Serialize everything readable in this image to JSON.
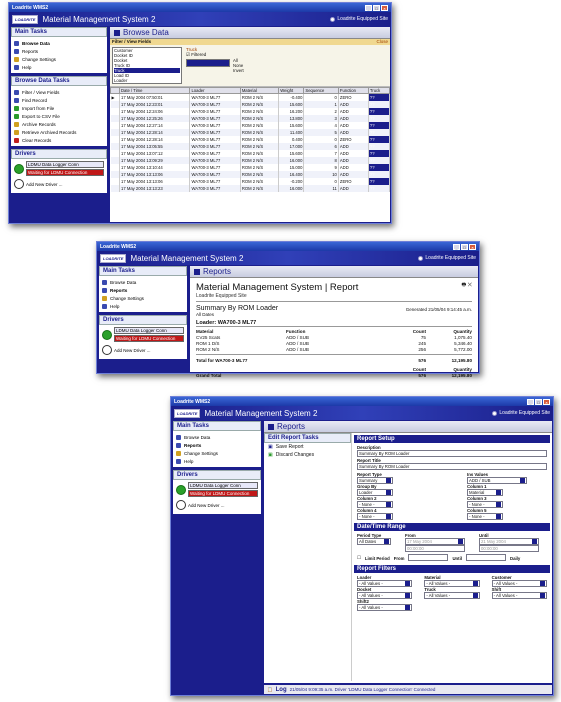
{
  "app": {
    "window_title": "Loadrite WMS2",
    "app_title": "Material Management System 2",
    "logo": "LOADRITE",
    "site": "Loadrite Equipped Site"
  },
  "sidebar": {
    "main_tasks_header": "Main Tasks",
    "main_tasks": [
      "Browse Data",
      "Reports",
      "Change Settings",
      "Help"
    ],
    "browse_tasks_header": "Browse Data Tasks",
    "browse_tasks": [
      "Filter / View Fields",
      "Find Record",
      "Import from File",
      "Export to CSV File",
      "Archive Records",
      "Retrieve Archived Records",
      "Clear Records"
    ],
    "drivers_header": "Drivers",
    "driver_name": "LDMU Data Logger Conn",
    "driver_status": "Waiting for LDMU Connection",
    "add_driver": "Add New Driver ..."
  },
  "browse": {
    "title": "Browse Data",
    "filter_header": "Filter / View Fields",
    "close": "Close",
    "fields": [
      "Customer",
      "Docket ID",
      "Docket",
      "Truck ID",
      "Truck",
      "Load ID",
      "Loader"
    ],
    "selected_field": "Truck",
    "filtered_label": "Filtered",
    "truck_label": "Truck",
    "opts": [
      "All",
      "None",
      "Invert"
    ],
    "columns": [
      "Date / Time",
      "Loader",
      "Material",
      "Weight",
      "Sequence",
      "Function",
      "Truck"
    ],
    "rows": [
      [
        "17 May 2004 07:50:01",
        "WA700-3 ML77",
        "ROM 2 N/S",
        "-0.400",
        "0",
        "ZERO",
        "??"
      ],
      [
        "17 May 2004 12:23:01",
        "WA700-3 ML77",
        "ROM 2 N/S",
        "15.600",
        "1",
        "ADD",
        "??"
      ],
      [
        "17 May 2004 12:24:06",
        "WA700-3 ML77",
        "ROM 2 N/S",
        "16.200",
        "2",
        "ADD",
        "??"
      ],
      [
        "17 May 2004 12:25:26",
        "WA700-3 ML77",
        "ROM 2 N/S",
        "13.800",
        "3",
        "ADD",
        "??"
      ],
      [
        "17 May 2004 12:27:14",
        "WA700-3 ML77",
        "ROM 2 N/S",
        "15.600",
        "4",
        "ADD",
        "??"
      ],
      [
        "17 May 2004 12:28:14",
        "WA700-3 ML77",
        "ROM 2 N/S",
        "11.400",
        "5",
        "ADD",
        "??"
      ],
      [
        "17 May 2004 12:28:14",
        "WA700-3 ML77",
        "ROM 2 N/S",
        "0.400",
        "0",
        "ZERO",
        "??"
      ],
      [
        "17 May 2004 13:05:55",
        "WA700-3 ML77",
        "ROM 2 N/S",
        "17.000",
        "6",
        "ADD",
        "??"
      ],
      [
        "17 May 2004 13:07:12",
        "WA700-3 ML77",
        "ROM 2 N/S",
        "15.600",
        "7",
        "ADD",
        "??"
      ],
      [
        "17 May 2004 13:09:29",
        "WA700-3 ML77",
        "ROM 2 N/S",
        "16.000",
        "8",
        "ADD",
        "??"
      ],
      [
        "17 May 2004 13:10:44",
        "WA700-3 ML77",
        "ROM 2 N/S",
        "15.000",
        "9",
        "ADD",
        "??"
      ],
      [
        "17 May 2004 13:13:06",
        "WA700-3 ML77",
        "ROM 2 N/S",
        "16.400",
        "10",
        "ADD",
        "??"
      ],
      [
        "17 May 2004 13:13:06",
        "WA700-3 ML77",
        "ROM 2 N/S",
        "-0.200",
        "0",
        "ZERO",
        "??"
      ],
      [
        "17 May 2004 13:13:23",
        "WA700-3 ML77",
        "ROM 2 N/S",
        "16.000",
        "11",
        "ADD",
        "??"
      ]
    ]
  },
  "report": {
    "title": "Reports",
    "heading": "Material Management System | Report",
    "site": "Loadrite Equipped Site",
    "name": "Summary By ROM Loader",
    "scope": "All Dates",
    "generated": "Generated 21/05/04 9:14:45 a.m.",
    "loader_heading": "Loader: WA700-3 ML77",
    "col_material": "Material",
    "col_function": "Function",
    "col_count": "Count",
    "col_quantity": "Quantity",
    "items": [
      [
        "CV25 Scats",
        "ADD / SUB",
        "75",
        "1,075.40"
      ],
      [
        "ROM 1 D/S",
        "ADD / SUB",
        "245",
        "5,346.40"
      ],
      [
        "ROM 2 N/S",
        "ADD / SUB",
        "256",
        "5,772.00"
      ]
    ],
    "total_label": "Total for WA700-3 ML77",
    "total_count": "576",
    "total_qty": "12,195.80",
    "grand_label": "Grand Total",
    "grand_count": "576",
    "grand_qty": "12,195.80"
  },
  "edit": {
    "title": "Reports",
    "tasks_header": "Edit Report Tasks",
    "save": "Save Report",
    "discard": "Discard Changes",
    "setup_header": "Report Setup",
    "description_label": "Description",
    "description_value": "Summary By ROM Loader",
    "rtitle_label": "Report Title",
    "rtitle_value": "Summary By ROM Loader",
    "type_label": "Report Type",
    "type_value": "Summary",
    "ins_label": "Ins Values",
    "ins_value": "ADD / SUB",
    "groupby_label": "Group By",
    "groupby_value": "Loader",
    "col1_label": "Column 1",
    "col1_value": "Material",
    "col2_label": "Column 2",
    "col2_value": "- None -",
    "col3_label": "Column 3",
    "col3_value": "- None -",
    "col4_label": "Column 4",
    "col4_value": "- None -",
    "col5_label": "Column 5",
    "col5_value": "- None -",
    "date_header": "Date/Time Range",
    "period_label": "Period Type",
    "period_value": "All Dates",
    "from_label": "From",
    "from_date": "17 May 2004",
    "from_time": "00:00:00",
    "until_label": "Until",
    "until_date": "21 May 2004",
    "until_time": "00:00:00",
    "limit_label": "Limit Period",
    "limit_from": "From",
    "limit_until": "Until",
    "limit_daily": "Daily",
    "filters_header": "Report Filters",
    "filters": [
      [
        "Loader",
        "- All Values -"
      ],
      [
        "Material",
        "- All Values -"
      ],
      [
        "Customer",
        "- All Values -"
      ],
      [
        "Docket",
        "- All Values -"
      ],
      [
        "Truck",
        "- All Values -"
      ],
      [
        "Shift",
        "- All Values -"
      ],
      [
        "Shift2",
        "- All Values -"
      ]
    ],
    "log_label": "Log",
    "log_text": "21/05/04 9:09:35 a.m. Driver 'LDMU Data Logger Connection' Connected"
  }
}
